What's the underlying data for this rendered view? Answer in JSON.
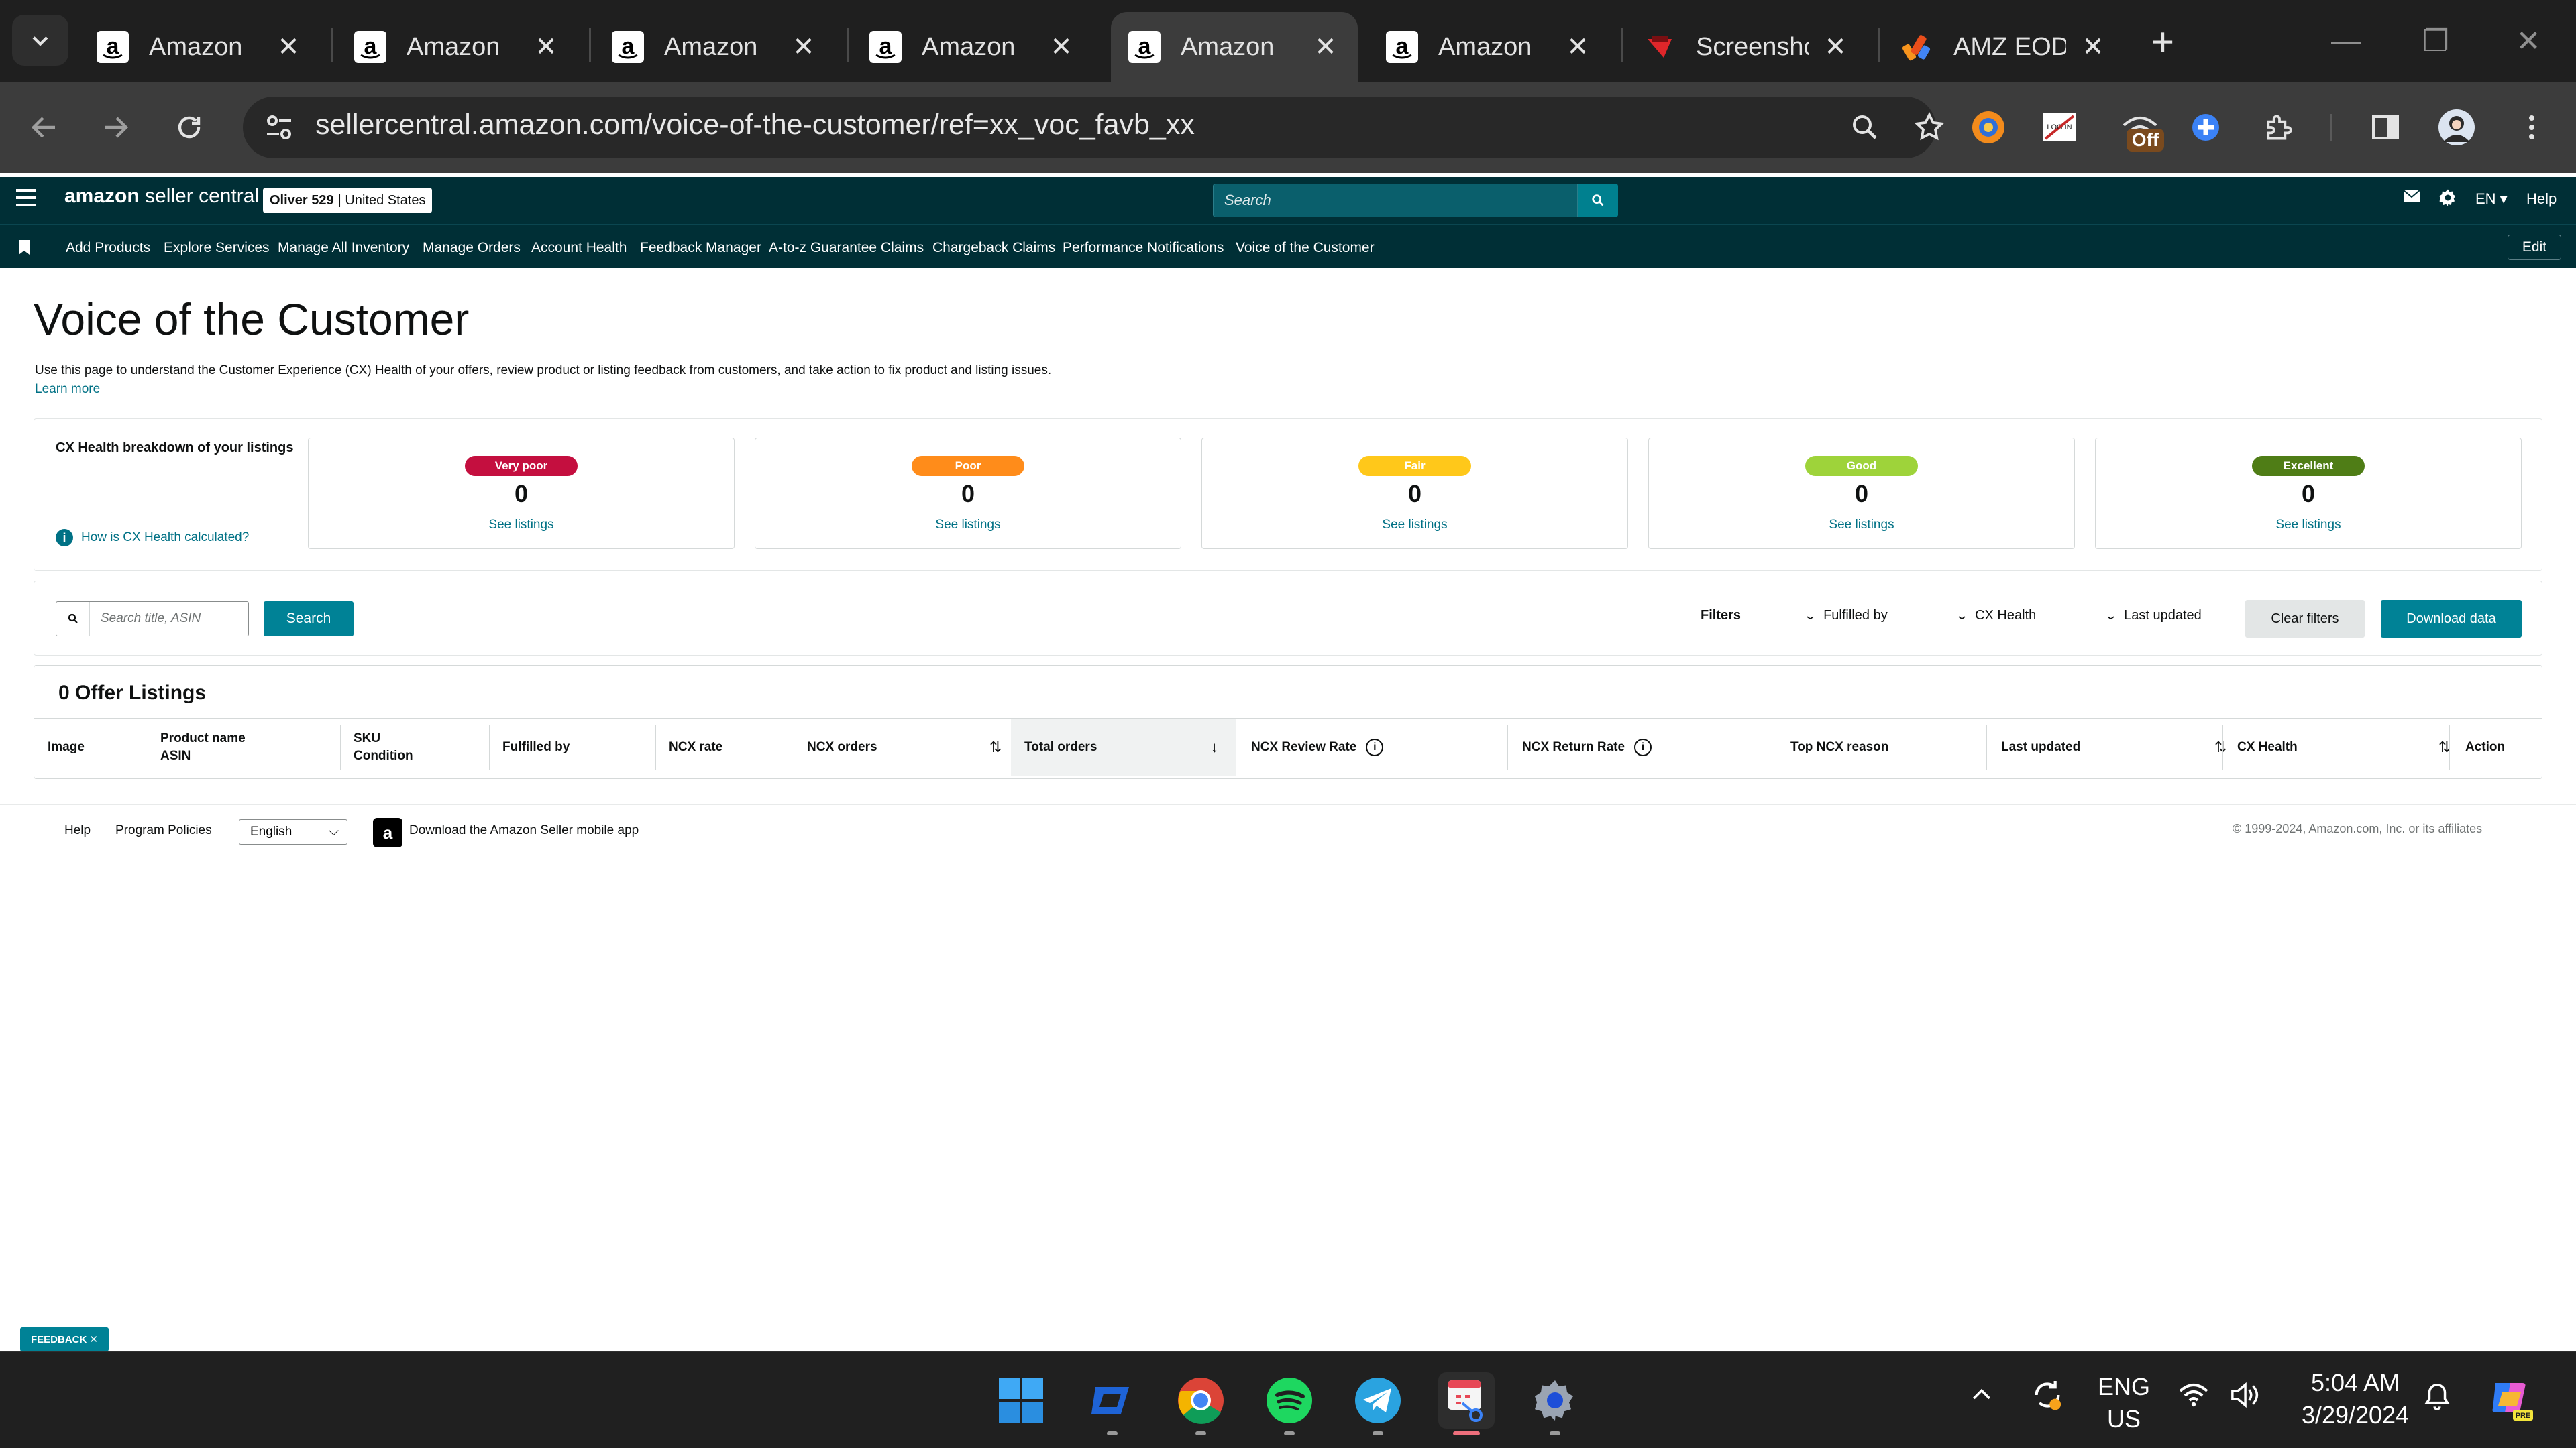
{
  "browser": {
    "tabs": [
      {
        "title": "Amazon",
        "icon": "amazon-icon"
      },
      {
        "title": "Amazon",
        "icon": "amazon-icon"
      },
      {
        "title": "Amazon",
        "icon": "amazon-icon"
      },
      {
        "title": "Amazon",
        "icon": "amazon-icon"
      },
      {
        "title": "Amazon",
        "icon": "amazon-icon",
        "active": true
      },
      {
        "title": "Amazon",
        "icon": "amazon-icon"
      },
      {
        "title": "Screensho",
        "icon": "screenshot-app-icon"
      },
      {
        "title": "AMZ EOD",
        "icon": "amz-eod-icon"
      }
    ],
    "url": "sellercentral.amazon.com/voice-of-the-customer/ref=xx_voc_favb_xx",
    "extension_badge": "Off"
  },
  "seller_central": {
    "logo_bold": "amazon",
    "logo_rest": " seller central",
    "store_name": "Oliver 529",
    "store_region": "| United States",
    "search_placeholder": "Search",
    "language": "EN",
    "help": "Help",
    "nav_links": [
      "Add Products",
      "Explore Services",
      "Manage All Inventory",
      "Manage Orders",
      "Account Health",
      "Feedback Manager",
      "A-to-z Guarantee Claims",
      "Chargeback Claims",
      "Performance Notifications",
      "Voice of the Customer"
    ],
    "edit": "Edit"
  },
  "page": {
    "title": "Voice of the Customer",
    "description": "Use this page to understand the Customer Experience (CX) Health of your offers, review product or listing feedback from customers, and take action to fix product and listing issues.",
    "learn_more": "Learn more"
  },
  "cx_health": {
    "heading": "CX Health breakdown of your listings",
    "how_link": "How is CX Health calculated?",
    "cards": [
      {
        "label": "Very poor",
        "count": "0",
        "link": "See listings",
        "color": "#c40f3f"
      },
      {
        "label": "Poor",
        "count": "0",
        "link": "See listings",
        "color": "#ff8c1a"
      },
      {
        "label": "Fair",
        "count": "0",
        "link": "See listings",
        "color": "#ffc81a"
      },
      {
        "label": "Good",
        "count": "0",
        "link": "See listings",
        "color": "#9ed33a"
      },
      {
        "label": "Excellent",
        "count": "0",
        "link": "See listings",
        "color": "#4f7d16"
      }
    ]
  },
  "filters": {
    "search_placeholder": "Search title, ASIN",
    "search_button": "Search",
    "label": "Filters",
    "dropdowns": [
      "Fulfilled by",
      "CX Health",
      "Last updated"
    ],
    "clear": "Clear filters",
    "download": "Download data"
  },
  "table": {
    "title": "0 Offer Listings",
    "columns": [
      {
        "line1": "Image",
        "line2": ""
      },
      {
        "line1": "Product name",
        "line2": "ASIN"
      },
      {
        "line1": "SKU",
        "line2": "Condition"
      },
      {
        "line1": "Fulfilled by",
        "line2": ""
      },
      {
        "line1": "NCX rate",
        "line2": ""
      },
      {
        "line1": "NCX orders",
        "line2": ""
      },
      {
        "line1": "Total orders",
        "line2": ""
      },
      {
        "line1": "NCX Review Rate",
        "line2": ""
      },
      {
        "line1": "NCX Return Rate",
        "line2": ""
      },
      {
        "line1": "Top NCX reason",
        "line2": ""
      },
      {
        "line1": "Last updated",
        "line2": ""
      },
      {
        "line1": "CX Health",
        "line2": ""
      },
      {
        "line1": "Action",
        "line2": ""
      }
    ]
  },
  "footer": {
    "help": "Help",
    "policies": "Program Policies",
    "language": "English",
    "app_link": "Download the Amazon Seller mobile app",
    "copyright": "© 1999-2024, Amazon.com, Inc. or its affiliates"
  },
  "feedback_tab": "FEEDBACK ✕",
  "taskbar": {
    "lang_line1": "ENG",
    "lang_line2": "US",
    "time": "5:04 AM",
    "date": "3/29/2024"
  }
}
